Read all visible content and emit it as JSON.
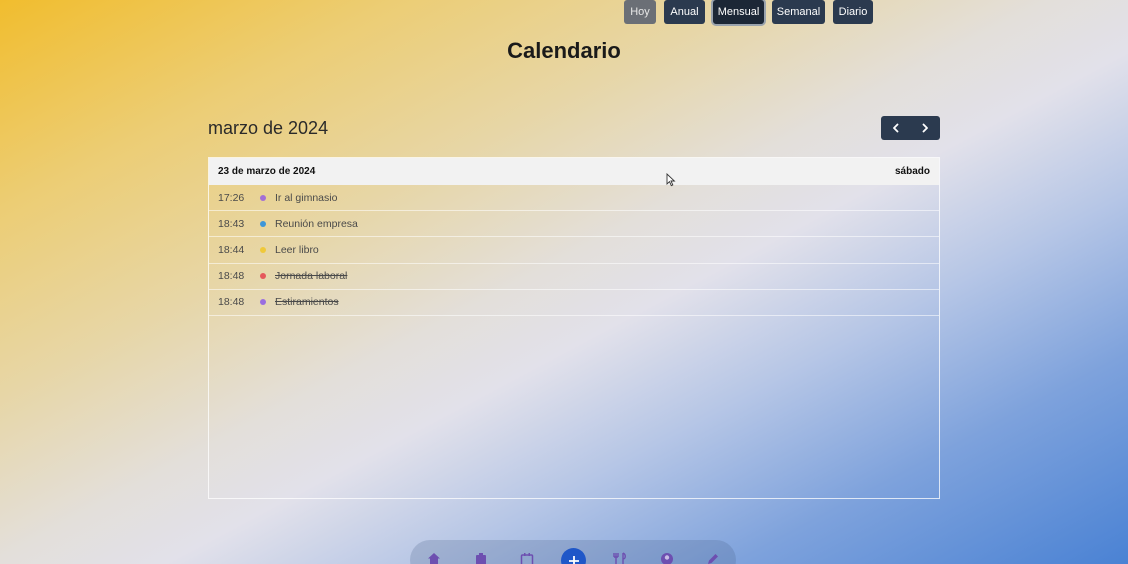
{
  "page": {
    "title": "Calendario"
  },
  "header": {
    "month_label": "marzo de 2024"
  },
  "toolbar": {
    "today_label": "Hoy",
    "views": [
      {
        "label": "Anual",
        "active": false
      },
      {
        "label": "Mensual",
        "active": true
      },
      {
        "label": "Semanal",
        "active": false
      },
      {
        "label": "Diario",
        "active": false
      }
    ],
    "prev_icon": "chevron-left-icon",
    "next_icon": "chevron-right-icon"
  },
  "day": {
    "date_label": "23 de marzo de 2024",
    "weekday_label": "sábado",
    "events": [
      {
        "time": "17:26",
        "title": "Ir al gimnasio",
        "color": "#a36fd6",
        "done": false
      },
      {
        "time": "18:43",
        "title": "Reunión empresa",
        "color": "#3d96d9",
        "done": false
      },
      {
        "time": "18:44",
        "title": "Leer libro",
        "color": "#efc93a",
        "done": false
      },
      {
        "time": "18:48",
        "title": "Jornada laboral",
        "color": "#e5585b",
        "done": true
      },
      {
        "time": "18:48",
        "title": "Estiramientos",
        "color": "#9a6ee0",
        "done": true
      }
    ]
  },
  "bottom_nav": {
    "items": [
      "home-icon",
      "tasks-icon",
      "calendar-icon",
      "add-icon",
      "food-icon",
      "profile-icon",
      "edit-icon"
    ]
  },
  "colors": {
    "button_bg": "#2b3a4f",
    "today_bg": "#6b6f76",
    "add_button": "#1f57c8"
  }
}
